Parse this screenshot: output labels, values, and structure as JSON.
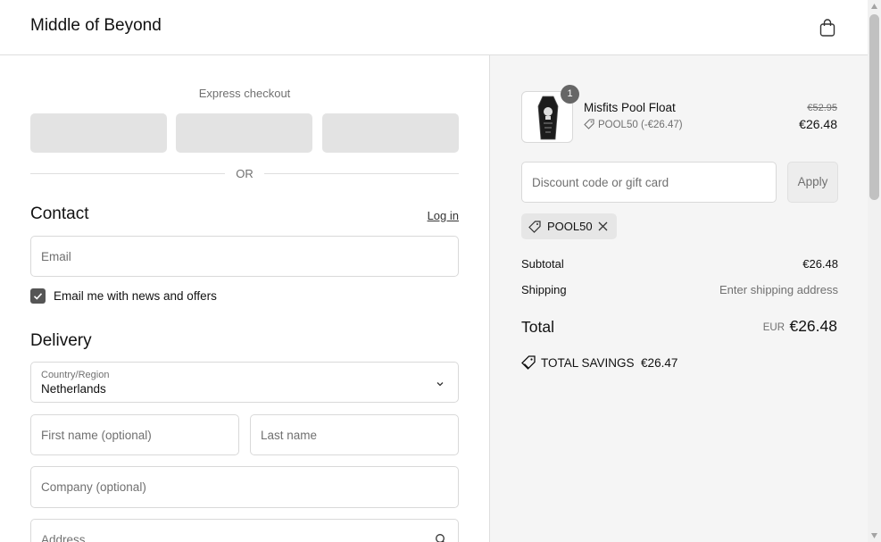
{
  "header": {
    "brand": "Middle of Beyond",
    "cart_icon": "shopping-bag-icon"
  },
  "express": {
    "title": "Express checkout",
    "separator": "OR"
  },
  "contact": {
    "title": "Contact",
    "login_link": "Log in",
    "email_placeholder": "Email",
    "newsletter_label": "Email me with news and offers",
    "newsletter_checked": true
  },
  "delivery": {
    "title": "Delivery",
    "country_label": "Country/Region",
    "country_value": "Netherlands",
    "first_name_placeholder": "First name (optional)",
    "last_name_placeholder": "Last name",
    "company_placeholder": "Company (optional)",
    "address_placeholder": "Address"
  },
  "order": {
    "item": {
      "name": "Misfits Pool Float",
      "quantity": "1",
      "discount_label": "POOL50 (-€26.47)",
      "original_price": "€52.95",
      "price": "€26.48"
    },
    "discount_placeholder": "Discount code or gift card",
    "apply_label": "Apply",
    "applied_code": "POOL50",
    "subtotal_label": "Subtotal",
    "subtotal_value": "€26.48",
    "shipping_label": "Shipping",
    "shipping_value": "Enter shipping address",
    "total_label": "Total",
    "total_currency": "EUR",
    "total_value": "€26.48",
    "savings_label": "TOTAL SAVINGS",
    "savings_value": "€26.47"
  },
  "colors": {
    "accent": "#555555",
    "summary_bg": "#f5f5f5",
    "express_button": "#e3e3e3"
  }
}
